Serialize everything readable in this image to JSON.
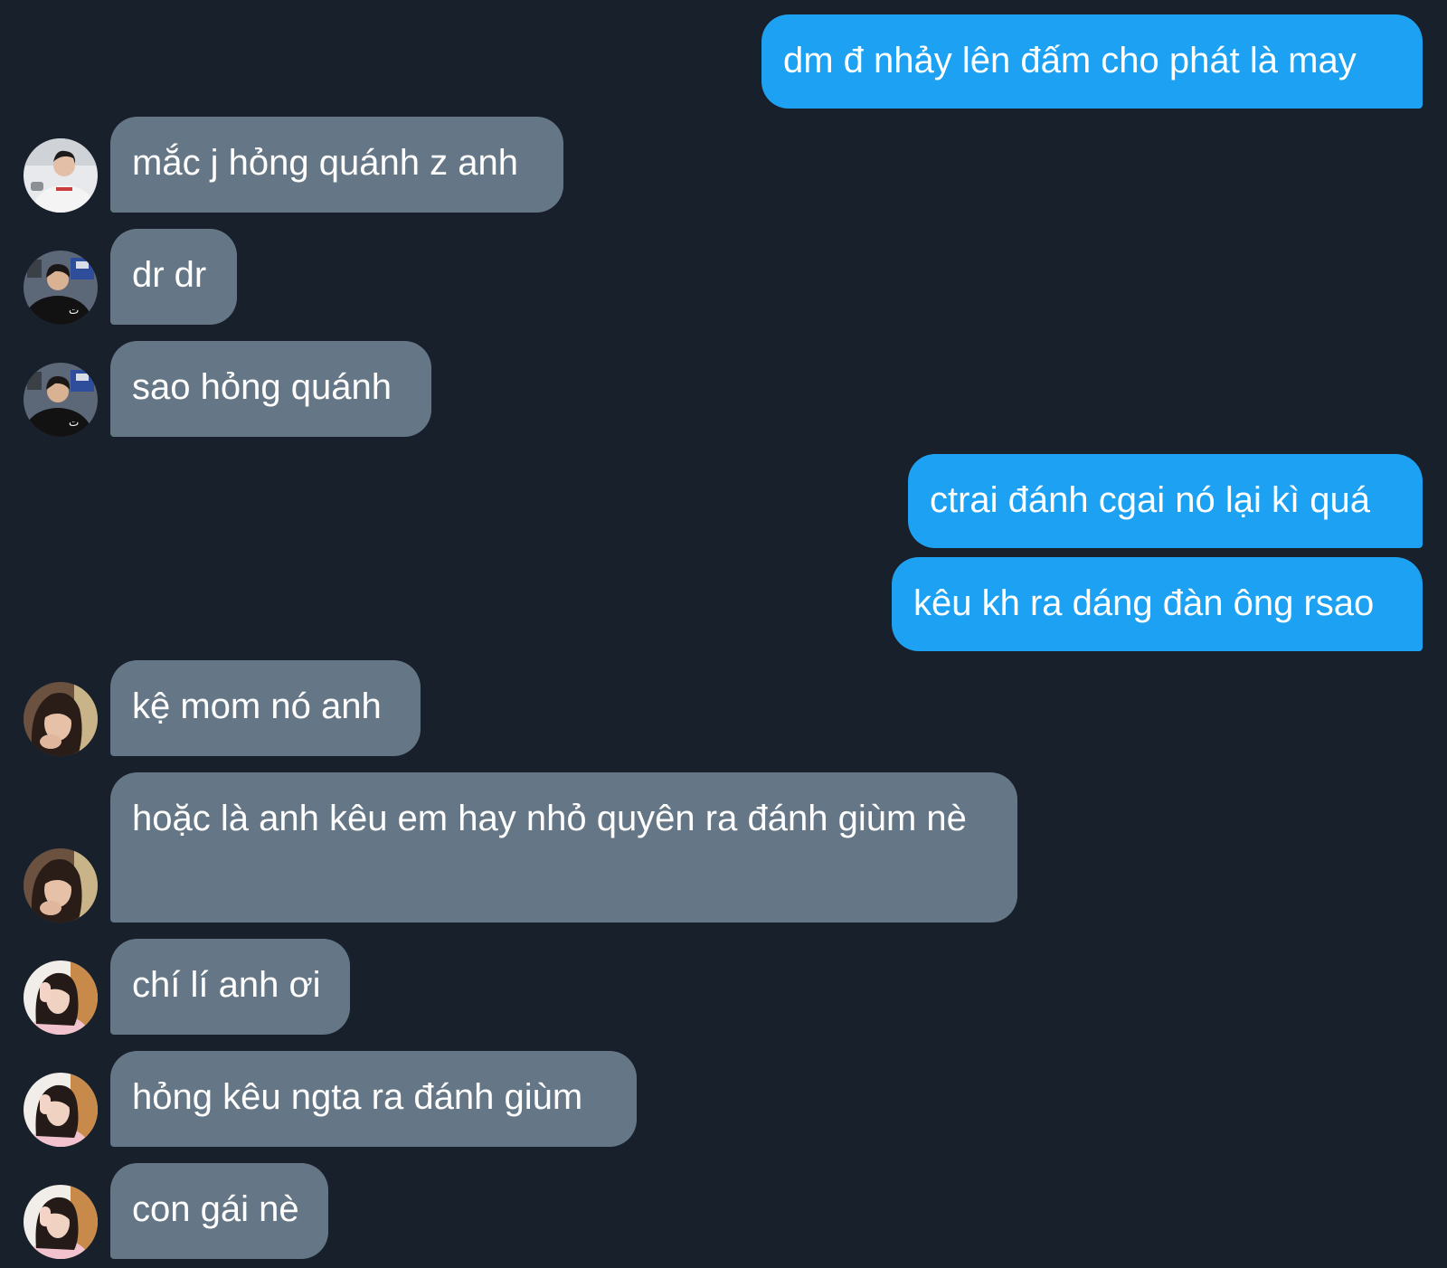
{
  "messages": [
    {
      "direction": "outgoing",
      "text": "dm đ nhảy lên đấm cho phát là may"
    },
    {
      "direction": "incoming",
      "avatar": "avatar-guy-white-shirt",
      "text": "mắc j hỏng quánh z anh"
    },
    {
      "direction": "incoming",
      "avatar": "avatar-guy-black-shirt",
      "text": "dr dr"
    },
    {
      "direction": "incoming",
      "avatar": "avatar-guy-black-shirt",
      "text": "sao hỏng quánh"
    },
    {
      "direction": "outgoing",
      "text": "ctrai đánh cgai nó lại kì quá"
    },
    {
      "direction": "outgoing",
      "text": "kêu kh ra dáng đàn ông rsao"
    },
    {
      "direction": "incoming",
      "avatar": "avatar-girl-dark-hair",
      "text": "kệ mom nó anh"
    },
    {
      "direction": "incoming",
      "avatar": "avatar-girl-dark-hair",
      "text": "hoặc là anh kêu em hay nhỏ quyên ra đánh giùm nè"
    },
    {
      "direction": "incoming",
      "avatar": "avatar-girl-pink-sweater",
      "text": "chí lí anh ơi"
    },
    {
      "direction": "incoming",
      "avatar": "avatar-girl-pink-sweater",
      "text": "hỏng kêu ngta ra đánh giùm"
    },
    {
      "direction": "incoming",
      "avatar": "avatar-girl-pink-sweater",
      "text": "con gái nè"
    }
  ],
  "colors": {
    "background": "#17202b",
    "outgoing_bubble": "#1da1f2",
    "incoming_bubble": "#657786",
    "text": "#ffffff"
  }
}
